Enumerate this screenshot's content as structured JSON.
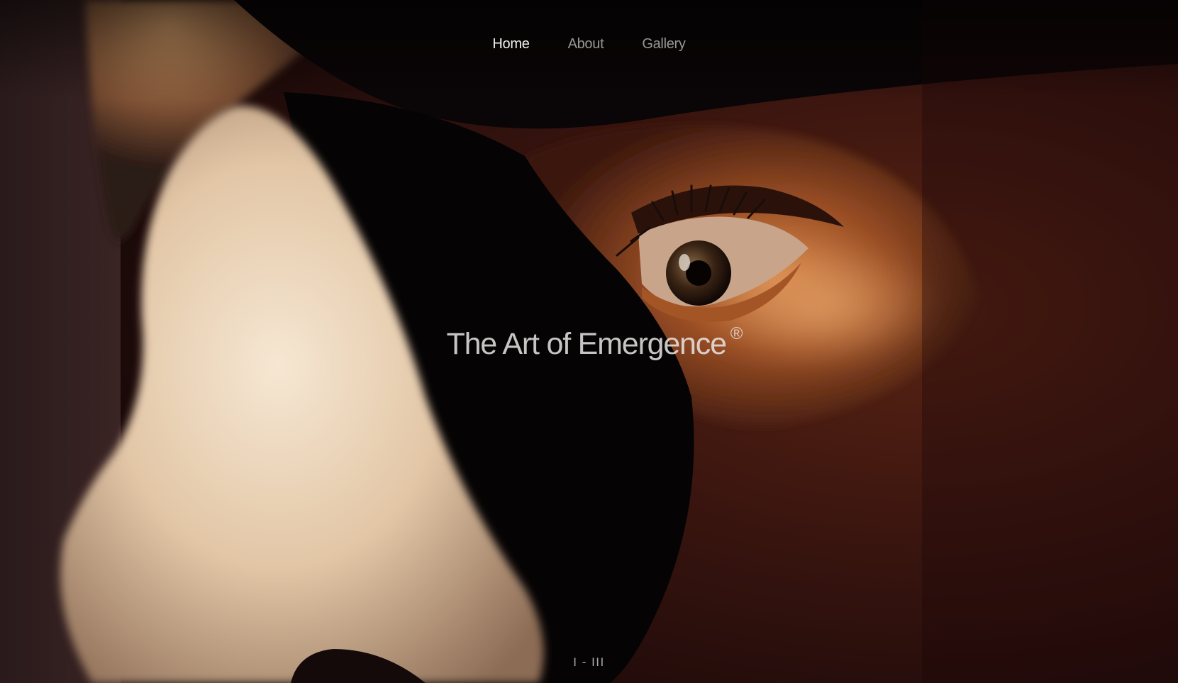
{
  "nav": {
    "items": [
      {
        "label": "Home",
        "active": true
      },
      {
        "label": "About",
        "active": false
      },
      {
        "label": "Gallery",
        "active": false
      }
    ]
  },
  "hero": {
    "title": "The Art of Emergence",
    "trademark": "®",
    "image": "closeup-eye-behind-mask"
  },
  "slider": {
    "counter": "I - III"
  },
  "colors": {
    "background": "#1a0b0b",
    "nav_active": "#f4f2f2",
    "nav_inactive": "#b8b3b3",
    "mask_highlight": "#f3e2cc",
    "skin_warm": "#b8692c"
  }
}
